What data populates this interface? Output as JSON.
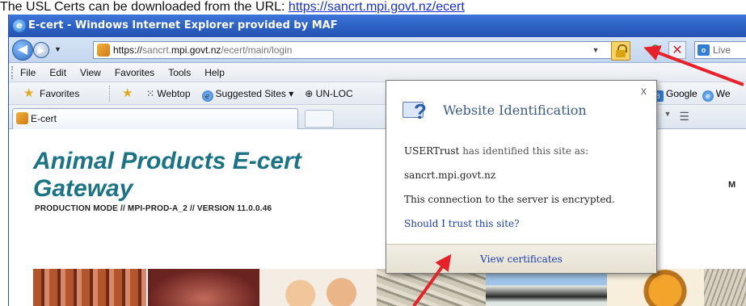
{
  "document": {
    "intro_text": "The USL Certs can be downloaded from the URL: ",
    "intro_link": "https://sancrt.mpi.govt.nz/ecert"
  },
  "window": {
    "title": "E-cert - Windows Internet Explorer provided by MAF"
  },
  "address_bar": {
    "scheme": "https://",
    "sub": "sancrt.",
    "domain": "mpi.govt.nz",
    "path": "/ecert/main/login"
  },
  "search": {
    "placeholder": "Live"
  },
  "menu": [
    "File",
    "Edit",
    "View",
    "Favorites",
    "Tools",
    "Help"
  ],
  "favorites_bar": {
    "label": "Favorites",
    "links": [
      {
        "label": "Webtop",
        "muted": false
      },
      {
        "label": "Suggested Sites ▾",
        "muted": true
      },
      {
        "label": "UN-LOC",
        "muted": false
      }
    ],
    "right_links": [
      "Google",
      "We"
    ]
  },
  "tab": {
    "label": "E-cert"
  },
  "page": {
    "title_line1": "Animal Products E-cert",
    "title_line2": "Gateway",
    "mode_line": "PRODUCTION MODE // MPI-PROD-A_2 // VERSION 11.0.0.46",
    "right_fragment": "M"
  },
  "popup": {
    "heading": "Website Identification",
    "issuer_name": "USERTrust",
    "issuer_suffix": " has identified this site as:",
    "site": "sancrt.mpi.govt.nz",
    "encrypted": "This connection to the server is encrypted.",
    "trust_link": "Should I trust this site?",
    "view_link": "View certificates",
    "close": "x"
  },
  "annotation_colors": {
    "arrow": "#e8202a"
  }
}
